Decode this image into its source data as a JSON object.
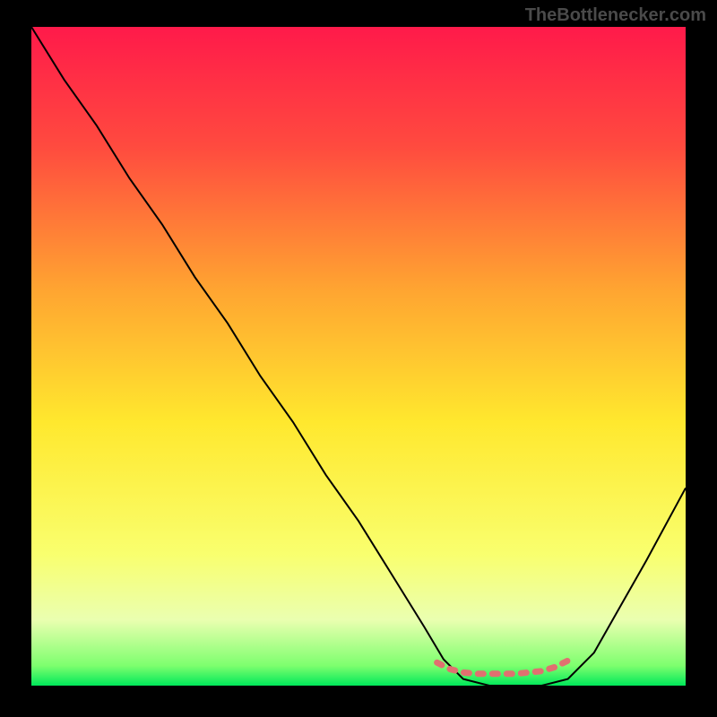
{
  "watermark": "TheBottlenecker.com",
  "chart_data": {
    "type": "line",
    "title": "",
    "xlabel": "",
    "ylabel": "",
    "xlim": [
      0,
      100
    ],
    "ylim": [
      0,
      100
    ],
    "gradient_stops": [
      {
        "offset": 0,
        "color": "#ff1a4a"
      },
      {
        "offset": 18,
        "color": "#ff4a3f"
      },
      {
        "offset": 40,
        "color": "#ffa531"
      },
      {
        "offset": 60,
        "color": "#ffe82e"
      },
      {
        "offset": 80,
        "color": "#f9ff6e"
      },
      {
        "offset": 90,
        "color": "#eaffb0"
      },
      {
        "offset": 97,
        "color": "#7dff6e"
      },
      {
        "offset": 100,
        "color": "#00e85a"
      }
    ],
    "series": [
      {
        "name": "bottleneck-curve",
        "color": "#000000",
        "x": [
          0,
          5,
          10,
          15,
          20,
          25,
          30,
          35,
          40,
          45,
          50,
          55,
          60,
          63,
          66,
          70,
          74,
          78,
          82,
          86,
          90,
          94,
          100
        ],
        "y": [
          100,
          92,
          85,
          77,
          70,
          62,
          55,
          47,
          40,
          32,
          25,
          17,
          9,
          4,
          1,
          0,
          0,
          0,
          1,
          5,
          12,
          19,
          30
        ]
      },
      {
        "name": "optimal-marker",
        "color": "#e07070",
        "style": "dashed-thick",
        "x": [
          62,
          64,
          66,
          68,
          70,
          72,
          74,
          76,
          78,
          80,
          82
        ],
        "y": [
          3.5,
          2.5,
          2,
          1.8,
          1.8,
          1.8,
          1.8,
          2,
          2.2,
          2.8,
          3.8
        ]
      }
    ]
  }
}
